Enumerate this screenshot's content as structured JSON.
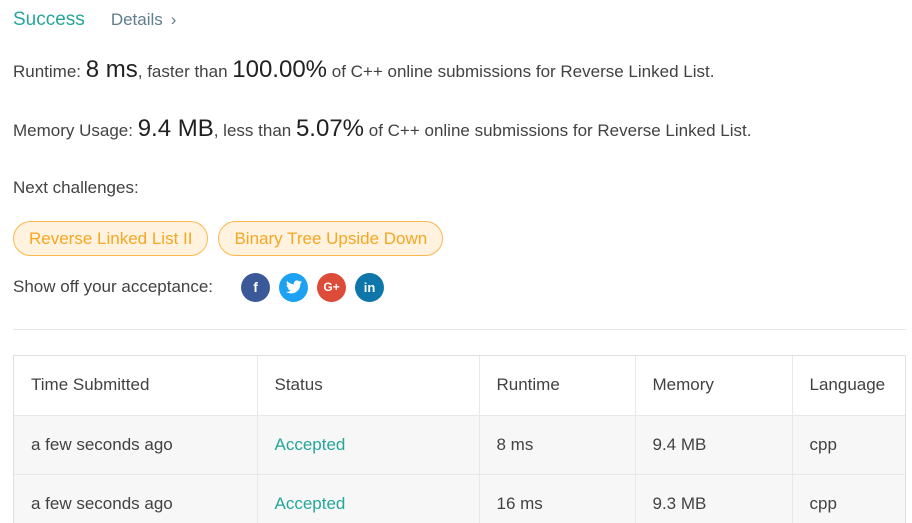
{
  "header": {
    "status": "Success",
    "details_label": "Details",
    "details_chevron": "›"
  },
  "runtime": {
    "prefix": "Runtime: ",
    "value": "8 ms",
    "middle": ", faster than ",
    "percent": "100.00%",
    "suffix": " of C++ online submissions for Reverse Linked List."
  },
  "memory": {
    "prefix": "Memory Usage: ",
    "value": "9.4 MB",
    "middle": ", less than ",
    "percent": "5.07%",
    "suffix": " of C++ online submissions for Reverse Linked List."
  },
  "next": {
    "label": "Next challenges:",
    "items": [
      {
        "label": "Reverse Linked List II"
      },
      {
        "label": "Binary Tree Upside Down"
      }
    ]
  },
  "share": {
    "label": "Show off your acceptance:",
    "icons": [
      {
        "name": "facebook-icon",
        "glyph": "f"
      },
      {
        "name": "twitter-icon",
        "glyph": "t"
      },
      {
        "name": "google-plus-icon",
        "glyph": "G+"
      },
      {
        "name": "linkedin-icon",
        "glyph": "in"
      }
    ]
  },
  "table": {
    "headers": [
      "Time Submitted",
      "Status",
      "Runtime",
      "Memory",
      "Language"
    ],
    "rows": [
      {
        "time": "a few seconds ago",
        "status": "Accepted",
        "runtime": "8 ms",
        "memory": "9.4 MB",
        "language": "cpp"
      },
      {
        "time": "a few seconds ago",
        "status": "Accepted",
        "runtime": "16 ms",
        "memory": "9.3 MB",
        "language": "cpp"
      }
    ]
  },
  "colors": {
    "success": "#26a69a",
    "chip_text": "#f5a623",
    "chip_border": "#ffb74d",
    "chip_bg": "#fff3e0"
  }
}
